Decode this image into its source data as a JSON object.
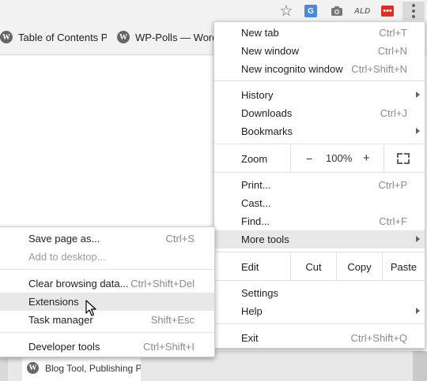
{
  "bookmarks": [
    {
      "label": "Table of Contents Plu"
    },
    {
      "label": "WP-Polls — Word"
    }
  ],
  "toolbar": {
    "star_icon": "star-icon",
    "ald_label": "ALD",
    "red_badge": "•••"
  },
  "main_menu": {
    "items": [
      {
        "label": "New tab",
        "shortcut": "Ctrl+T"
      },
      {
        "label": "New window",
        "shortcut": "Ctrl+N"
      },
      {
        "label": "New incognito window",
        "shortcut": "Ctrl+Shift+N"
      },
      {
        "label": "History"
      },
      {
        "label": "Downloads",
        "shortcut": "Ctrl+J"
      },
      {
        "label": "Bookmarks"
      },
      {
        "label": "Print...",
        "shortcut": "Ctrl+P"
      },
      {
        "label": "Cast..."
      },
      {
        "label": "Find...",
        "shortcut": "Ctrl+F"
      },
      {
        "label": "More tools"
      },
      {
        "label": "Settings"
      },
      {
        "label": "Help"
      },
      {
        "label": "Exit",
        "shortcut": "Ctrl+Shift+Q"
      }
    ],
    "zoom": {
      "label": "Zoom",
      "minus": "−",
      "value": "100%",
      "plus": "+"
    },
    "edit": {
      "label": "Edit",
      "cut": "Cut",
      "copy": "Copy",
      "paste": "Paste"
    }
  },
  "sub_menu": {
    "items": [
      {
        "label": "Save page as...",
        "shortcut": "Ctrl+S"
      },
      {
        "label": "Add to desktop..."
      },
      {
        "label": "Clear browsing data...",
        "shortcut": "Ctrl+Shift+Del"
      },
      {
        "label": "Extensions"
      },
      {
        "label": "Task manager",
        "shortcut": "Shift+Esc"
      },
      {
        "label": "Developer tools",
        "shortcut": "Ctrl+Shift+I"
      }
    ]
  },
  "page": {
    "tab_label": "Blog Tool, Publishing Platform"
  }
}
